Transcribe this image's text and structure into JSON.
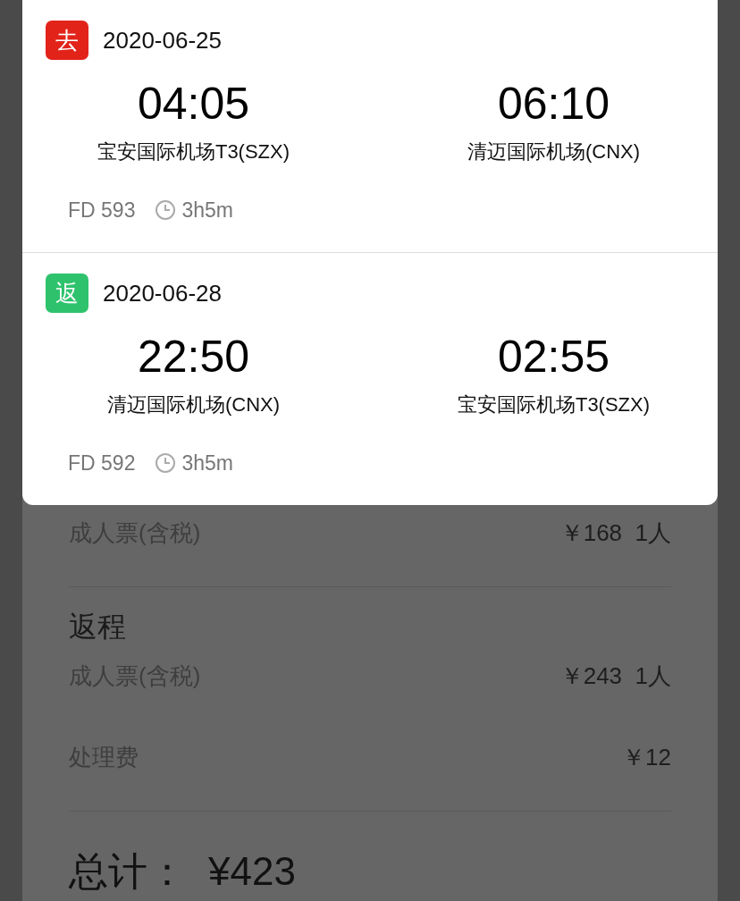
{
  "legs": [
    {
      "tag": "去",
      "color": "#e2231a",
      "date": "2020-06-25",
      "depart": {
        "time": "04:05",
        "airport": "宝安国际机场T3(SZX)"
      },
      "arrive": {
        "time": "06:10",
        "airport": "清迈国际机场(CNX)"
      },
      "flight_no": "FD 593",
      "duration": "3h5m"
    },
    {
      "tag": "返",
      "color": "#2fc26d",
      "date": "2020-06-28",
      "depart": {
        "time": "22:50",
        "airport": "清迈国际机场(CNX)"
      },
      "arrive": {
        "time": "02:55",
        "airport": "宝安国际机场T3(SZX)"
      },
      "flight_no": "FD 592",
      "duration": "3h5m"
    }
  ],
  "fare_sections": [
    {
      "divider": true,
      "rows": [
        {
          "label": "成人票(含税)",
          "price": "￥168",
          "count": "1人"
        }
      ]
    },
    {
      "title": "返程",
      "divider": false,
      "rows": [
        {
          "label": "成人票(含税)",
          "price": "￥243",
          "count": "1人"
        }
      ]
    },
    {
      "divider": true,
      "rows": [
        {
          "label": "处理费",
          "price": "￥12"
        }
      ]
    }
  ],
  "total": {
    "label": "总计：",
    "amount": "¥423"
  }
}
